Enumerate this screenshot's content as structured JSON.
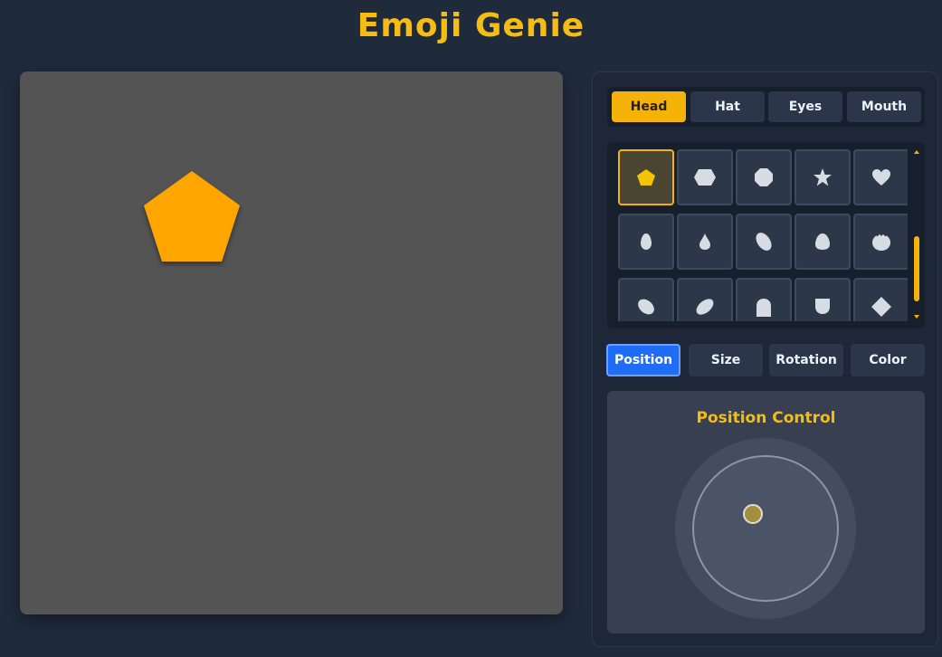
{
  "app": {
    "title": "Emoji Genie"
  },
  "canvas": {
    "head_color": "#ffa500",
    "head_shape": "pentagon"
  },
  "category_tabs": [
    {
      "label": "Head",
      "active": true
    },
    {
      "label": "Hat",
      "active": false
    },
    {
      "label": "Eyes",
      "active": false
    },
    {
      "label": "Mouth",
      "active": false
    }
  ],
  "shape_options": [
    {
      "icon": "pentagon-icon",
      "selected": true,
      "color": "#f5c400"
    },
    {
      "icon": "hexagon-icon"
    },
    {
      "icon": "octagon-icon"
    },
    {
      "icon": "star-icon"
    },
    {
      "icon": "heart-icon"
    },
    {
      "icon": "egg-icon"
    },
    {
      "icon": "teardrop-icon"
    },
    {
      "icon": "tilted-oval-icon"
    },
    {
      "icon": "egg-round-icon"
    },
    {
      "icon": "tomato-icon"
    },
    {
      "icon": "tilted-ellipse-icon"
    },
    {
      "icon": "leaf-oval-icon"
    },
    {
      "icon": "arch-icon"
    },
    {
      "icon": "shield-icon"
    },
    {
      "icon": "diamond-icon"
    }
  ],
  "property_tabs": [
    {
      "label": "Position",
      "active": true
    },
    {
      "label": "Size",
      "active": false
    },
    {
      "label": "Rotation",
      "active": false
    },
    {
      "label": "Color",
      "active": false
    }
  ],
  "control": {
    "title": "Position Control"
  },
  "colors": {
    "accent": "#f5b30a",
    "active_blue": "#1f6cf6",
    "background": "#1f2a3b",
    "canvas": "#545454",
    "icon_gray": "#d7dce3"
  }
}
